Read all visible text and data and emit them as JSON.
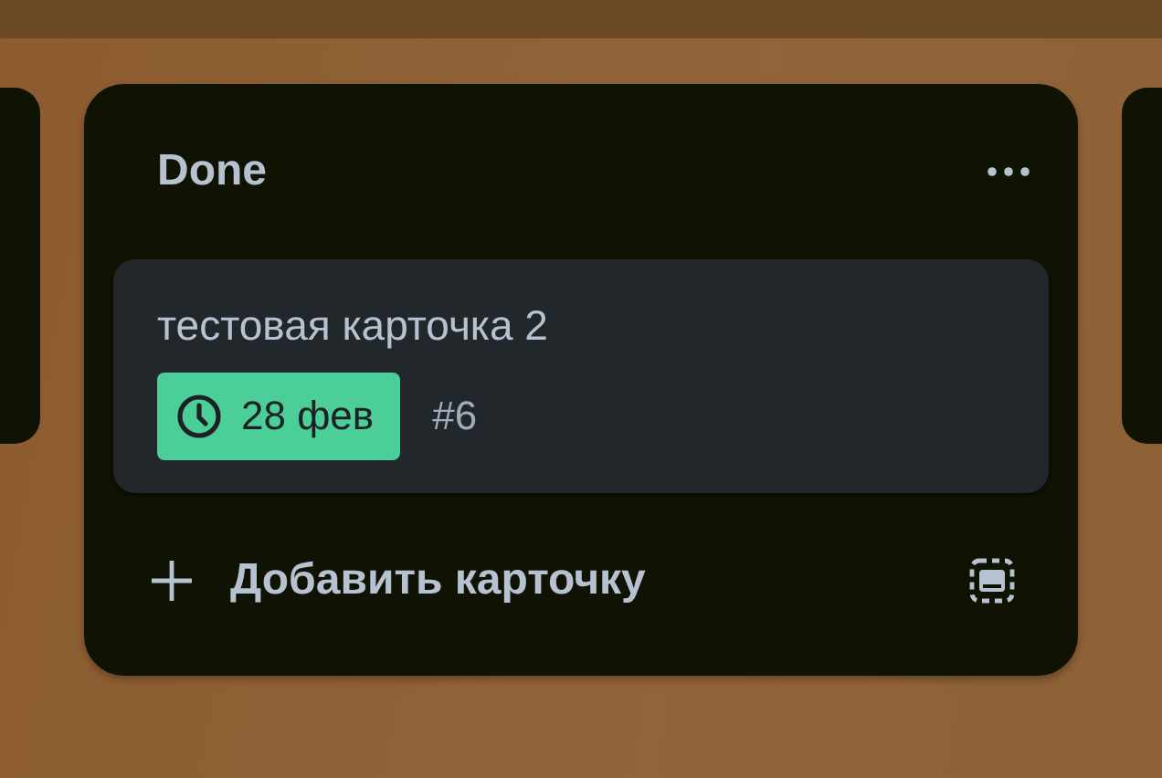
{
  "list": {
    "title": "Done",
    "cards": [
      {
        "title": "тестовая карточка 2",
        "due": {
          "text": "28 фев",
          "complete": true
        },
        "number": "#6"
      }
    ],
    "add_button": "Добавить карточку"
  }
}
